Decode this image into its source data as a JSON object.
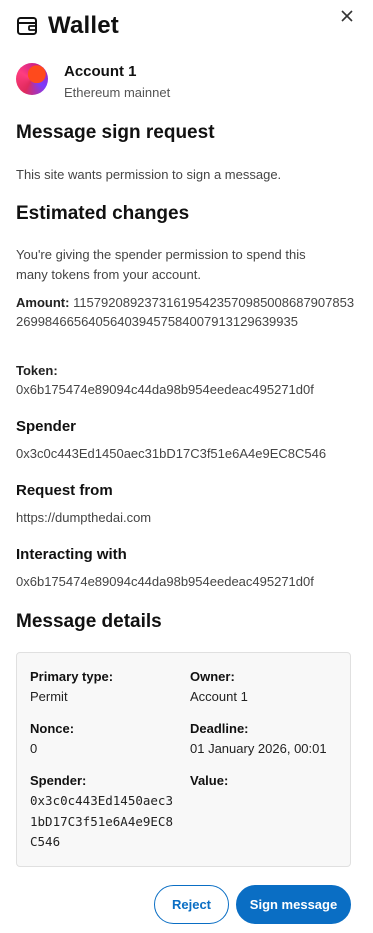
{
  "header": {
    "title": "Wallet",
    "icon": "wallet-icon",
    "close_icon": "close-icon"
  },
  "account": {
    "name": "Account 1",
    "network": "Ethereum mainnet"
  },
  "request": {
    "title": "Message sign request",
    "description": "This site wants permission to sign a message."
  },
  "changes": {
    "title": "Estimated changes",
    "description_line1": "You're giving the spender permission to spend this",
    "description_line2": "many tokens from your account.",
    "amount_label": "Amount:",
    "amount_value": "115792089237316195423570985008687907853269984665640564039457584007913129639935",
    "token_label": "Token:",
    "token_value": "0x6b175474e89094c44da98b954eedeac495271d0f"
  },
  "fields": {
    "spender_label": "Spender",
    "spender_value": "0x3c0c443Ed1450aec31bD17C3f51e6A4e9EC8C546",
    "request_from_label": "Request from",
    "request_from_value": "https://dumpthedai.com",
    "interacting_label": "Interacting with",
    "interacting_value": "0x6b175474e89094c44da98b954eedeac495271d0f"
  },
  "details": {
    "title": "Message details",
    "primary_type_label": "Primary type:",
    "primary_type_value": "Permit",
    "owner_label": "Owner:",
    "owner_value": "Account 1",
    "nonce_label": "Nonce:",
    "nonce_value": "0",
    "deadline_label": "Deadline:",
    "deadline_value": "01 January 2026, 00:01",
    "spender_label": "Spender:",
    "spender_value": "0x3c0c443Ed1450aec31bD17C3f51e6A4e9EC8C546",
    "value_label": "Value:",
    "value_value": ""
  },
  "buttons": {
    "reject": "Reject",
    "sign": "Sign message"
  },
  "colors": {
    "accent": "#0a6ec4",
    "box_bg": "#f8f8f8",
    "border": "#e0e0e0"
  }
}
